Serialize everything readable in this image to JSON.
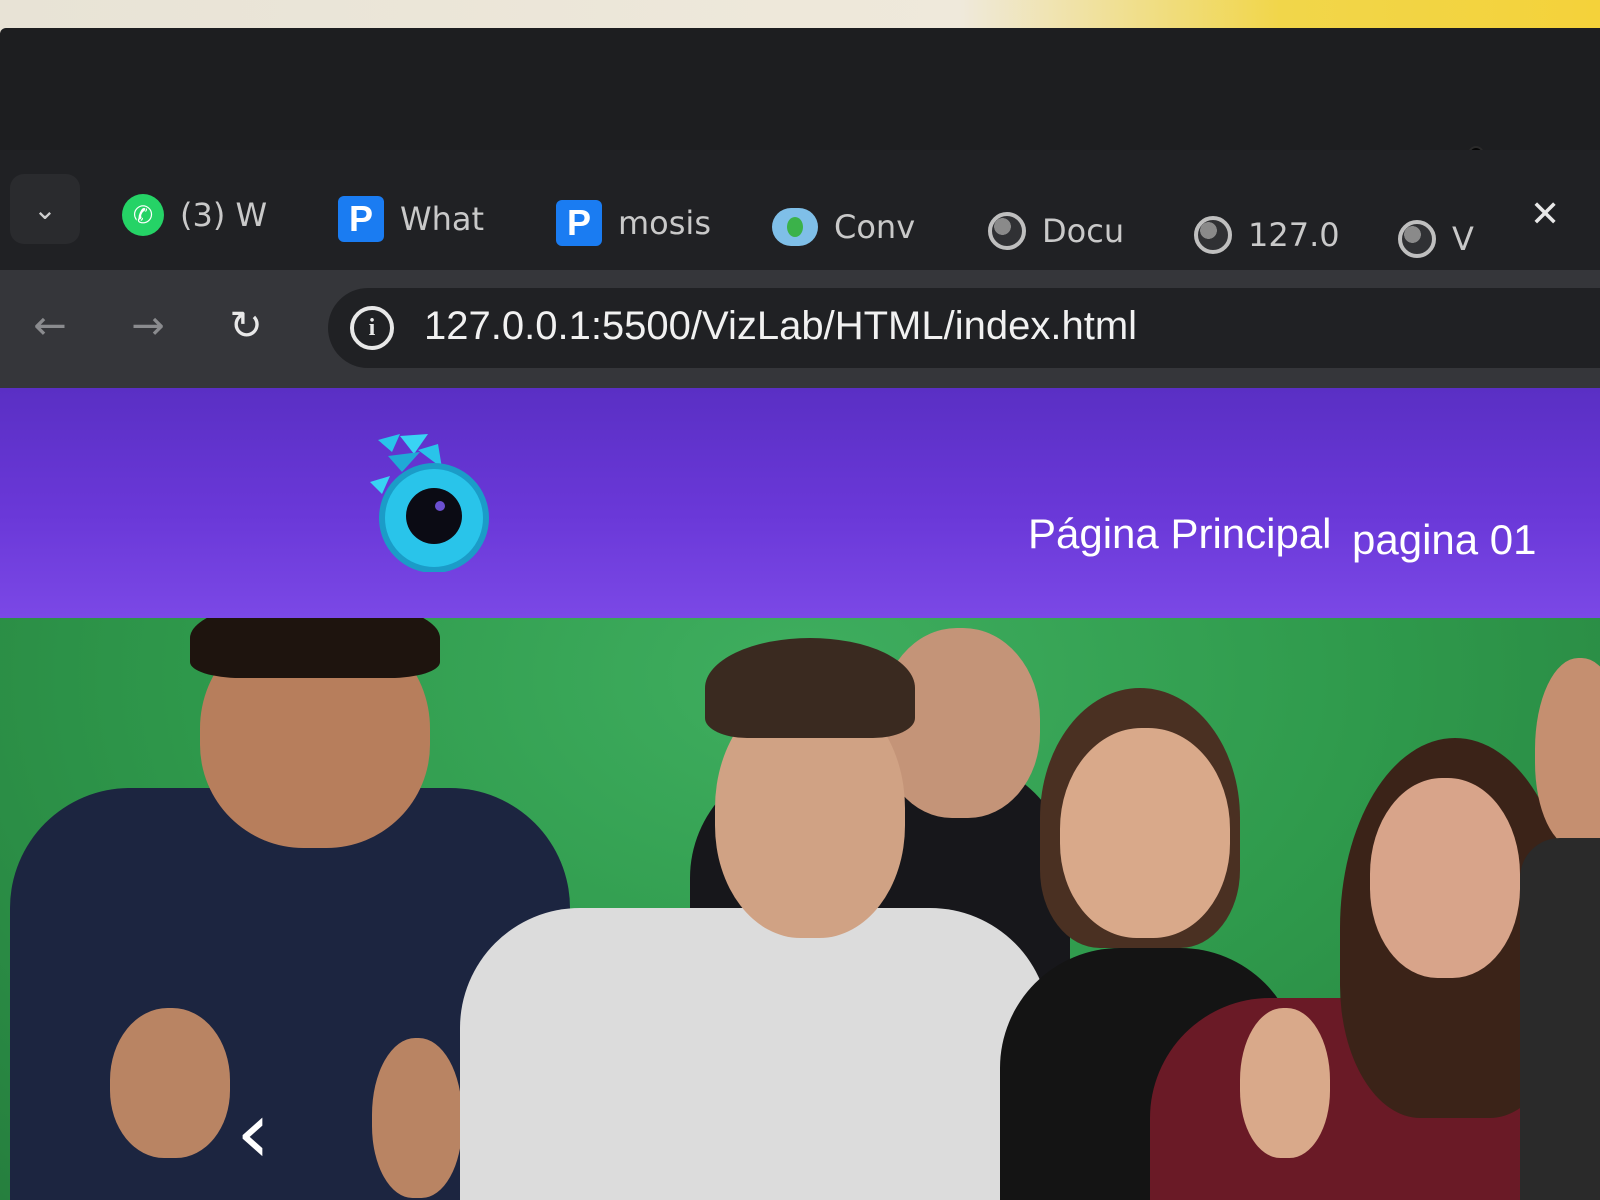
{
  "browser": {
    "tabs": [
      {
        "label": "(3) W",
        "icon": "whatsapp-icon"
      },
      {
        "label": "What",
        "icon": "p-app-icon"
      },
      {
        "label": "mosis",
        "icon": "p-app-icon"
      },
      {
        "label": "Conv",
        "icon": "cloud-icon"
      },
      {
        "label": "Docu",
        "icon": "globe-icon"
      },
      {
        "label": "127.0",
        "icon": "globe-icon"
      },
      {
        "label": "V",
        "icon": "globe-icon"
      }
    ],
    "tab_dropdown_glyph": "⌄",
    "close_glyph": "✕",
    "nav": {
      "back": "←",
      "forward": "→",
      "reload": "↻"
    },
    "info_glyph": "i",
    "url": "127.0.0.1:5500/VizLab/HTML/index.html"
  },
  "site": {
    "nav": [
      {
        "label": "Página Principal"
      },
      {
        "label": "pagina 01"
      }
    ],
    "carousel_prev_glyph": "‹",
    "colors": {
      "header_top": "#5a2fc4",
      "header_bottom": "#7b48e6",
      "hero_bg": "#2f9a4c",
      "logo": "#29c4ea"
    }
  }
}
